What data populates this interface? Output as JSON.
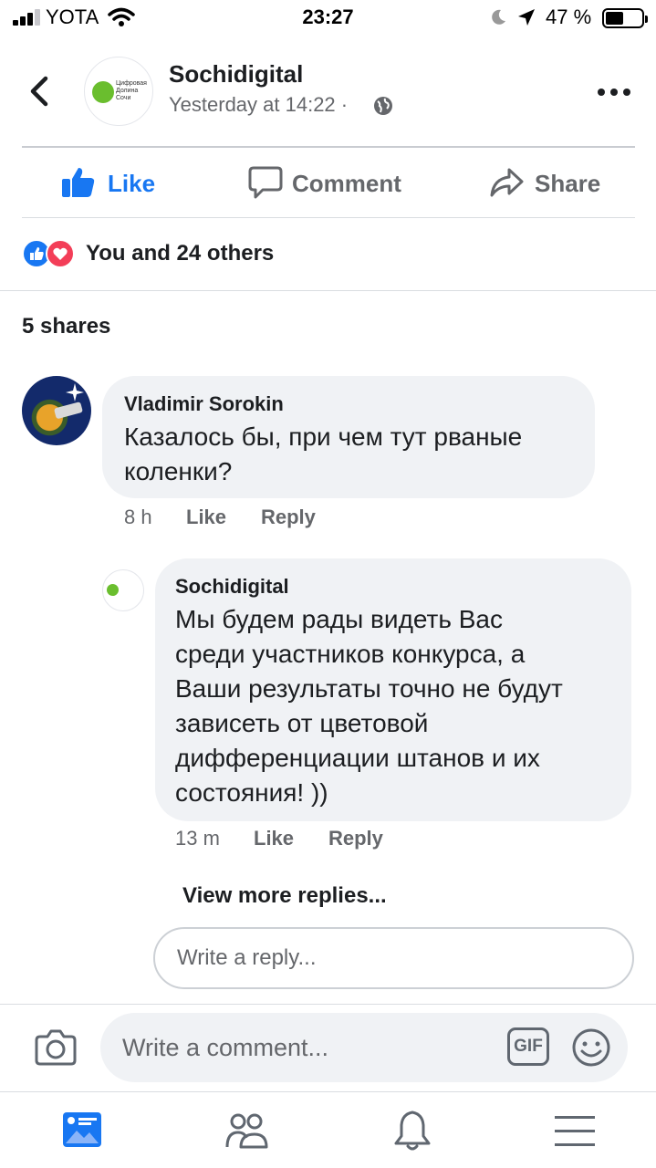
{
  "status_bar": {
    "carrier": "YOTA",
    "time": "23:27",
    "battery": "47 %",
    "battery_level": 0.47
  },
  "post_header": {
    "page_name": "Sochidigital",
    "timestamp": "Yesterday at 14:22 ·",
    "logo_text": "Цифровая Долина Сочи",
    "privacy_icon": "globe-icon"
  },
  "actions": {
    "like": "Like",
    "comment": "Comment",
    "share": "Share"
  },
  "reactions": {
    "summary": "You and 24 others",
    "icons": [
      "like-reaction-icon",
      "love-reaction-icon"
    ]
  },
  "shares": "5 shares",
  "comments": [
    {
      "author": "Vladimir Sorokin",
      "text_lines": [
        "Казалось бы,  при чем тут рваные",
        "коленки?"
      ],
      "time": "8 h",
      "like": "Like",
      "reply": "Reply",
      "replies": [
        {
          "author": "Sochidigital",
          "text_lines": [
            "Мы будем рады видеть Вас",
            "среди участников конкурса, а",
            "Ваши результаты точно не будут",
            "зависеть от цветовой",
            "дифференциации штанов и их",
            "состояния! ))"
          ],
          "time": "13 m",
          "like": "Like",
          "reply": "Reply"
        }
      ]
    }
  ],
  "view_more_replies": "View more replies...",
  "reply_placeholder": "Write a reply...",
  "composer": {
    "placeholder": "Write a comment...",
    "gif_label": "GIF"
  },
  "colors": {
    "accent": "#1877f2",
    "love": "#f33e58",
    "text_secondary": "#65676b",
    "bubble": "#f0f2f5"
  },
  "tab_bar": [
    "news-feed-icon",
    "friends-icon",
    "notifications-bell-icon",
    "menu-icon"
  ]
}
